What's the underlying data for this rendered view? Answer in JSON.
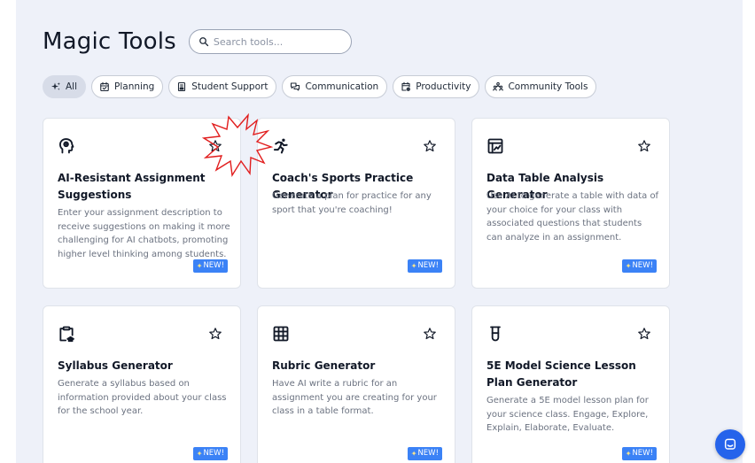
{
  "header": {
    "title": "Magic Tools",
    "search_placeholder": "Search tools..."
  },
  "filters": [
    {
      "label": "All",
      "icon": "sparkles-icon",
      "active": true
    },
    {
      "label": "Planning",
      "icon": "calendar-check-icon",
      "active": false
    },
    {
      "label": "Student Support",
      "icon": "clipboard-icon",
      "active": false
    },
    {
      "label": "Communication",
      "icon": "chat-bubbles-icon",
      "active": false
    },
    {
      "label": "Productivity",
      "icon": "calendar-settings-icon",
      "active": false
    },
    {
      "label": "Community Tools",
      "icon": "community-icon",
      "active": false
    }
  ],
  "cards": [
    {
      "title": "AI-Resistant Assignment Suggestions",
      "description": "Enter your assignment description to receive suggestions on making it more challenging for AI chatbots, promoting higher level thinking among students.",
      "badge": "NEW!",
      "icon": "brain-head-icon"
    },
    {
      "title": "Coach's Sports Practice Generator",
      "description": "Generate a plan for practice for any sport that you're coaching!",
      "badge": "NEW!",
      "icon": "running-person-icon"
    },
    {
      "title": "Data Table Analysis Generator",
      "description": "Use AI to generate a table with data of your choice for your class with associated questions that students can analyze in an assignment.",
      "badge": "NEW!",
      "icon": "data-table-icon"
    },
    {
      "title": "Syllabus Generator",
      "description": "Generate a syllabus based on information provided about your class for the school year.",
      "badge": "NEW!",
      "icon": "syllabus-icon"
    },
    {
      "title": "Rubric Generator",
      "description": "Have AI write a rubric for an assignment you are creating for your class in a table format.",
      "badge": "NEW!",
      "icon": "grid-table-icon"
    },
    {
      "title": "5E Model Science Lesson Plan Generator",
      "description": "Generate a 5E model lesson plan for your science class. Engage, Explore, Explain, Elaborate, Evaluate.",
      "badge": "NEW!",
      "icon": "test-tube-icon"
    }
  ],
  "colors": {
    "background": "#eef1f9",
    "badge": "#3b82f6",
    "chat_button": "#2563eb",
    "annotation": "#e11d1d"
  }
}
